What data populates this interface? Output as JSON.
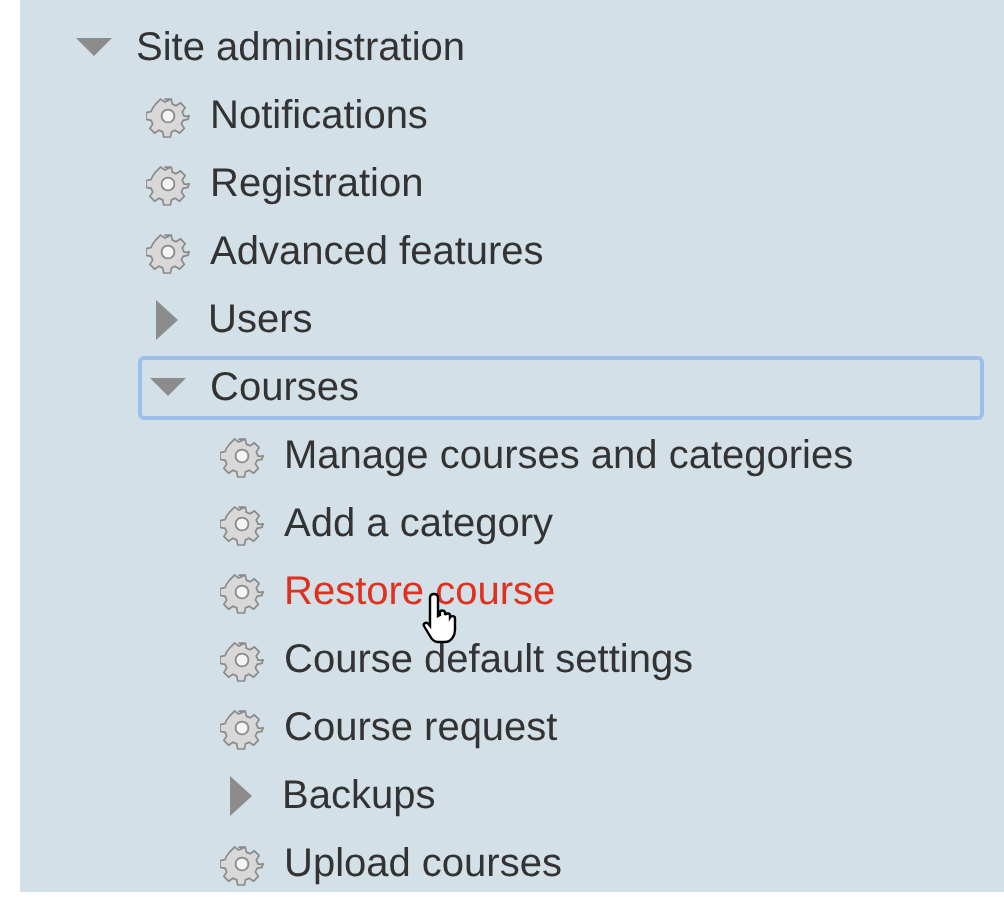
{
  "tree": [
    {
      "label": "Site administration",
      "kind": "branch",
      "expanded": true,
      "focused": false,
      "hovered": false,
      "children": [
        {
          "label": "Notifications",
          "kind": "leaf",
          "focused": false,
          "hovered": false
        },
        {
          "label": "Registration",
          "kind": "leaf",
          "focused": false,
          "hovered": false
        },
        {
          "label": "Advanced features",
          "kind": "leaf",
          "focused": false,
          "hovered": false
        },
        {
          "label": "Users",
          "kind": "branch",
          "expanded": false,
          "focused": false,
          "hovered": false
        },
        {
          "label": "Courses",
          "kind": "branch",
          "expanded": true,
          "focused": true,
          "hovered": false,
          "children": [
            {
              "label": "Manage courses and categories",
              "kind": "leaf",
              "focused": false,
              "hovered": false
            },
            {
              "label": "Add a category",
              "kind": "leaf",
              "focused": false,
              "hovered": false
            },
            {
              "label": "Restore course",
              "kind": "leaf",
              "focused": false,
              "hovered": true
            },
            {
              "label": "Course default settings",
              "kind": "leaf",
              "focused": false,
              "hovered": false
            },
            {
              "label": "Course request",
              "kind": "leaf",
              "focused": false,
              "hovered": false
            },
            {
              "label": "Backups",
              "kind": "branch",
              "expanded": false,
              "focused": false,
              "hovered": false
            },
            {
              "label": "Upload courses",
              "kind": "leaf",
              "focused": false,
              "hovered": false
            }
          ]
        }
      ]
    }
  ]
}
